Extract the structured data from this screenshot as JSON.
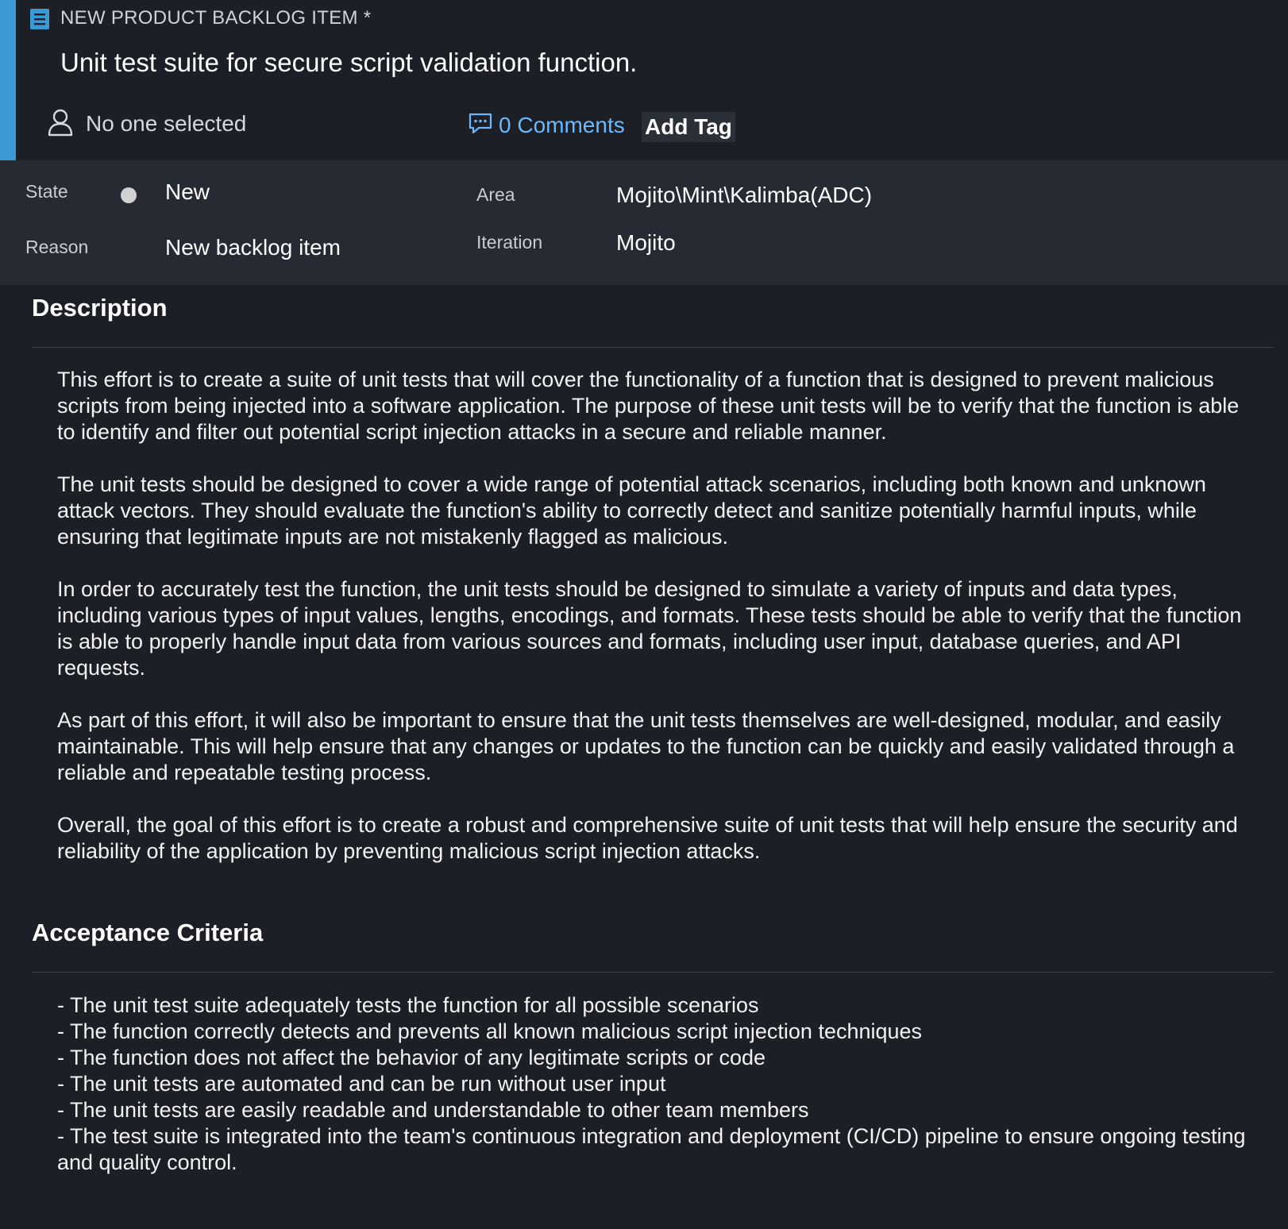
{
  "header": {
    "type_label": "NEW PRODUCT BACKLOG ITEM *",
    "type_icon": "backlog-item-icon",
    "title": "Unit test suite for secure script validation function.",
    "assignee": "No one selected",
    "assignee_icon": "person-icon",
    "comments_label": "0 Comments",
    "comments_icon": "comment-icon",
    "add_tag_label": "Add Tag",
    "accent_color": "#3b9ad4",
    "link_color": "#6cb8ff"
  },
  "fields": {
    "state_label": "State",
    "state_value": "New",
    "reason_label": "Reason",
    "reason_value": "New backlog item",
    "area_label": "Area",
    "area_value": "Mojito\\Mint\\Kalimba(ADC)",
    "iteration_label": "Iteration",
    "iteration_value": "Mojito"
  },
  "description": {
    "heading": "Description",
    "paragraphs": [
      "This effort is to create a suite of unit tests that will cover the functionality of a function that is designed to prevent malicious scripts from being injected into a software application. The purpose of these unit tests will be to verify that the function is able to identify and filter out potential script injection attacks in a secure and reliable manner.",
      "The unit tests should be designed to cover a wide range of potential attack scenarios, including both known and unknown attack vectors. They should evaluate the function's ability to correctly detect and sanitize potentially harmful inputs, while ensuring that legitimate inputs are not mistakenly flagged as malicious.",
      "In order to accurately test the function, the unit tests should be designed to simulate a variety of inputs and data types, including various types of input values, lengths, encodings, and formats. These tests should be able to verify that the function is able to properly handle input data from various sources and formats, including user input, database queries, and API requests.",
      "As part of this effort, it will also be important to ensure that the unit tests themselves are well-designed, modular, and easily maintainable. This will help ensure that any changes or updates to the function can be quickly and easily validated through a reliable and repeatable testing process.",
      "Overall, the goal of this effort is to create a robust and comprehensive suite of unit tests that will help ensure the security and reliability of the application by preventing malicious script injection attacks."
    ]
  },
  "acceptance": {
    "heading": "Acceptance Criteria",
    "items": [
      "- The unit test suite adequately tests the function for all possible scenarios",
      "- The function correctly detects and prevents all known malicious script injection techniques",
      "- The function does not affect the behavior of any legitimate scripts or code",
      "- The unit tests are automated and can be run without user input",
      "- The unit tests are easily readable and understandable to other team members",
      "- The test suite is integrated into the team's continuous integration and deployment (CI/CD) pipeline to ensure ongoing testing and quality control."
    ]
  }
}
